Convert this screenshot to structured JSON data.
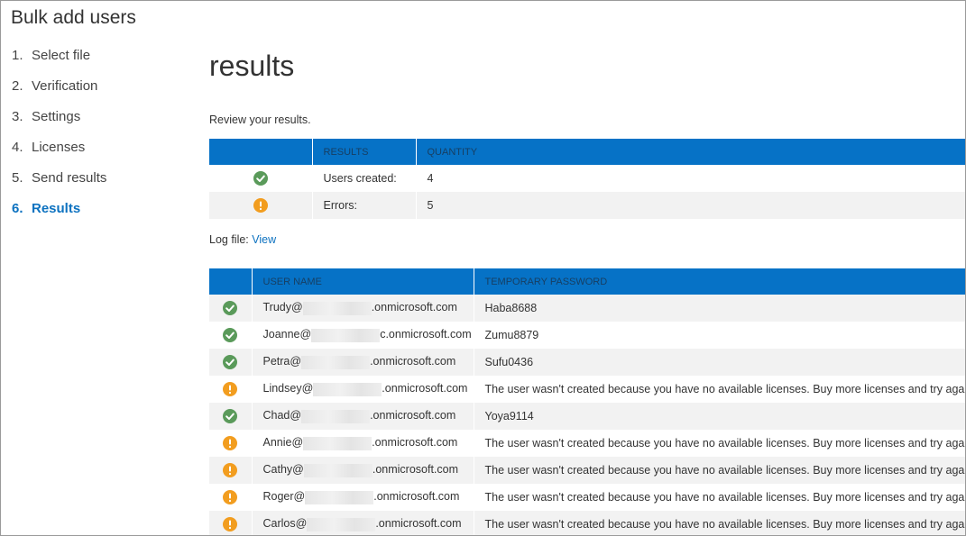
{
  "wizard": {
    "title": "Bulk add users"
  },
  "steps": [
    {
      "num": "1.",
      "label": "Select file"
    },
    {
      "num": "2.",
      "label": "Verification"
    },
    {
      "num": "3.",
      "label": "Settings"
    },
    {
      "num": "4.",
      "label": "Licenses"
    },
    {
      "num": "5.",
      "label": "Send results"
    },
    {
      "num": "6.",
      "label": "Results"
    }
  ],
  "main": {
    "title": "results",
    "intro": "Review your results.",
    "log_label": "Log file:",
    "log_link": "View"
  },
  "summary": {
    "headers": [
      "RESULTS",
      "QUANTITY"
    ],
    "rows": [
      {
        "status": "success",
        "icon": "checkmark-icon",
        "label": "Users created:",
        "value": "4"
      },
      {
        "status": "error",
        "icon": "exclamation-icon",
        "label": "Errors:",
        "value": "5"
      }
    ]
  },
  "users": {
    "headers": [
      "USER NAME",
      "TEMPORARY PASSWORD"
    ],
    "rows": [
      {
        "status": "success",
        "name": "Trudy@",
        "domain": ".onmicrosoft.com",
        "result": "Haba8688"
      },
      {
        "status": "success",
        "name": "Joanne@",
        "domain": "c.onmicrosoft.com",
        "result": "Zumu8879"
      },
      {
        "status": "success",
        "name": "Petra@",
        "domain": ".onmicrosoft.com",
        "result": "Sufu0436"
      },
      {
        "status": "error",
        "name": "Lindsey@",
        "domain": ".onmicrosoft.com",
        "result": "The user wasn't created because you have no available licenses. Buy more licenses and try again."
      },
      {
        "status": "success",
        "name": "Chad@",
        "domain": ".onmicrosoft.com",
        "result": "Yoya9114"
      },
      {
        "status": "error",
        "name": "Annie@",
        "domain": ".onmicrosoft.com",
        "result": "The user wasn't created because you have no available licenses. Buy more licenses and try again."
      },
      {
        "status": "error",
        "name": "Cathy@",
        "domain": ".onmicrosoft.com",
        "result": "The user wasn't created because you have no available licenses. Buy more licenses and try again."
      },
      {
        "status": "error",
        "name": "Roger@",
        "domain": ".onmicrosoft.com",
        "result": "The user wasn't created because you have no available licenses. Buy more licenses and try again."
      },
      {
        "status": "error",
        "name": "Carlos@",
        "domain": ".onmicrosoft.com",
        "result": "The user wasn't created because you have no available licenses. Buy more licenses and try again."
      }
    ]
  },
  "colors": {
    "accent": "#0672c6",
    "link": "#0d72c0",
    "success": "#5a9a5a",
    "warning": "#f29d1f"
  }
}
